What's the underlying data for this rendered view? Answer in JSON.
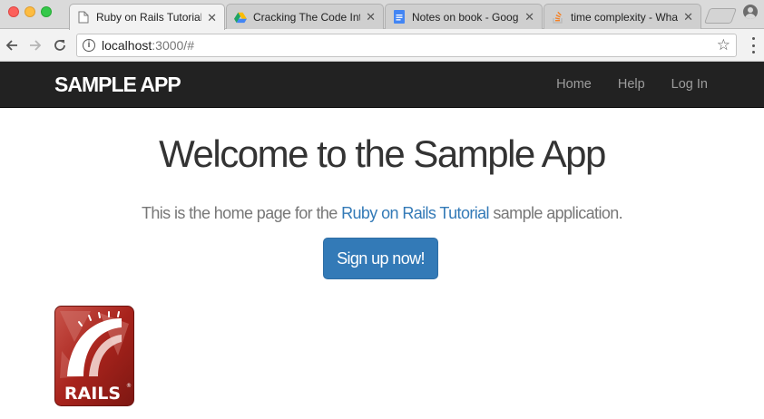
{
  "browser": {
    "tabs": [
      {
        "title": "Ruby on Rails Tutorial",
        "favicon": "page-icon",
        "active": true
      },
      {
        "title": "Cracking The Code Interview",
        "favicon": "drive-icon",
        "active": false
      },
      {
        "title": "Notes on book - Google Docs",
        "favicon": "docs-icon",
        "active": false
      },
      {
        "title": "time complexity - What",
        "favicon": "stackoverflow-icon",
        "active": false
      }
    ],
    "url_host": "localhost",
    "url_rest": ":3000/#",
    "info_glyph": "i",
    "close_glyph": "✕"
  },
  "navbar": {
    "brand": "sample app",
    "links": [
      "Home",
      "Help",
      "Log In"
    ],
    "colors": {
      "background": "#222222",
      "link": "#9d9d9d"
    }
  },
  "main": {
    "title": "Welcome to the Sample App",
    "lead_before": "This is the home page for the ",
    "lead_link": "Ruby on Rails Tutorial",
    "lead_after": " sample application.",
    "signup_label": "Sign up now!",
    "logo_text": "RAILS",
    "colors": {
      "primary": "#337ab7",
      "logo_red": "#a8231c"
    }
  }
}
